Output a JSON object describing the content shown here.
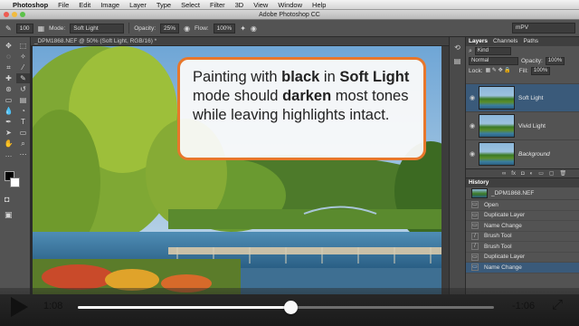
{
  "menubar": {
    "app": "Photoshop",
    "items": [
      "File",
      "Edit",
      "Image",
      "Layer",
      "Type",
      "Select",
      "Filter",
      "3D",
      "View",
      "Window",
      "Help"
    ]
  },
  "window": {
    "title": "Adobe Photoshop CC"
  },
  "options": {
    "brush_size": "100",
    "mode_label": "Mode:",
    "mode_value": "Soft Light",
    "opacity_label": "Opacity:",
    "opacity_value": "25%",
    "flow_label": "Flow:",
    "flow_value": "100%",
    "workspace": "mPV"
  },
  "document": {
    "tab_label": "_DPM1868.NEF @ 50% (Soft Light, RGB/16) *"
  },
  "callout": {
    "part1": "Painting with ",
    "part2": "black",
    "part3": " in ",
    "part4": "Soft Light",
    "part5": " mode should ",
    "part6": "darken",
    "part7": " most tones while leaving highlights intact."
  },
  "layers_panel": {
    "tabs": [
      "Layers",
      "Channels",
      "Paths"
    ],
    "kind_label": "Kind",
    "blend_mode": "Normal",
    "opacity_label": "Opacity:",
    "opacity_value": "100%",
    "lock_label": "Lock:",
    "fill_label": "Fill:",
    "fill_value": "100%",
    "layers": [
      "Soft Light",
      "Vivid Light",
      "Background"
    ]
  },
  "history_panel": {
    "title": "History",
    "snapshot": "_DPM1868.NEF",
    "items": [
      "Open",
      "Duplicate Layer",
      "Name Change",
      "Brush Tool",
      "Brush Tool",
      "Duplicate Layer",
      "Name Change"
    ]
  },
  "video": {
    "elapsed": "1:08",
    "remaining": "-1:06",
    "progress": 0.51
  }
}
